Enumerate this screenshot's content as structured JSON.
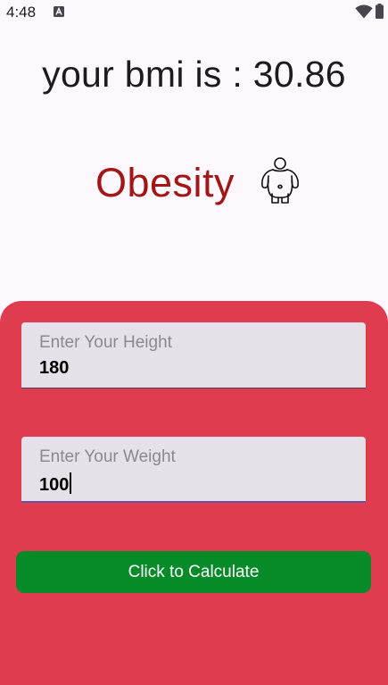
{
  "status_bar": {
    "time": "4:48",
    "icons": [
      "android-app-icon",
      "wifi-icon",
      "battery-icon"
    ]
  },
  "result": {
    "bmi_text": "your bmi is : 30.86",
    "category": "Obesity",
    "category_color": "#a31616",
    "category_icon": "obese-person-icon"
  },
  "form": {
    "height": {
      "label": "Enter Your Height",
      "value": "180"
    },
    "weight": {
      "label": "Enter Your Weight",
      "value": "100"
    },
    "calculate_label": "Click to Calculate"
  },
  "colors": {
    "panel": "#e03c50",
    "button": "#068b28",
    "field": "#e6e0e9"
  }
}
